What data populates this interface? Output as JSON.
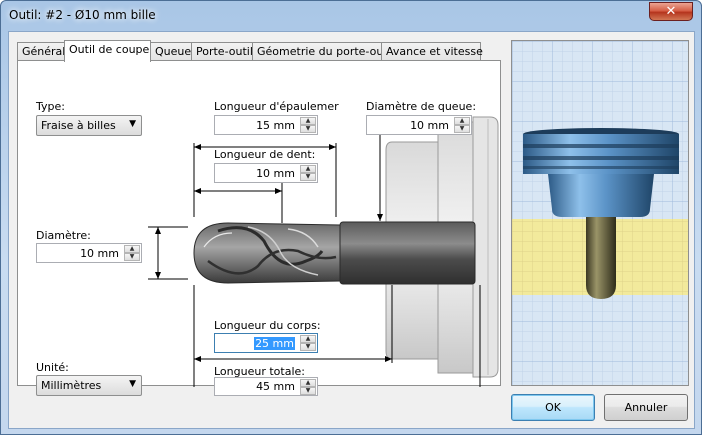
{
  "window": {
    "title": "Outil: #2 - Ø10 mm bille",
    "close_glyph": "✕"
  },
  "tabs": [
    {
      "label": "Général"
    },
    {
      "label": "Outil de coupe"
    },
    {
      "label": "Queue"
    },
    {
      "label": "Porte-outil"
    },
    {
      "label": "Géometrie du porte-outil"
    },
    {
      "label": "Avance et vitesse"
    }
  ],
  "active_tab": "Outil de coupe",
  "form": {
    "type": {
      "label": "Type:",
      "value": "Fraise à billes"
    },
    "shoulder_length": {
      "label": "Longueur d'épaulemer",
      "value": "15 mm"
    },
    "shank_diameter": {
      "label": "Diamètre de queue:",
      "value": "10 mm"
    },
    "flute_length": {
      "label": "Longueur de dent:",
      "value": "10 mm"
    },
    "diameter": {
      "label": "Diamètre:",
      "value": "10 mm"
    },
    "body_length": {
      "label": "Longueur du corps:",
      "value": "25 mm"
    },
    "overall_length": {
      "label": "Longueur totale:",
      "value": "45 mm"
    },
    "unit": {
      "label": "Unité:",
      "value": "Millimètres"
    }
  },
  "buttons": {
    "ok": "OK",
    "cancel": "Annuler"
  },
  "colors": {
    "accent_selection": "#3399ff",
    "preview_stock": "#f2ea9c",
    "preview_holder": "#5b93c7",
    "preview_tool": "#6f6a45"
  }
}
